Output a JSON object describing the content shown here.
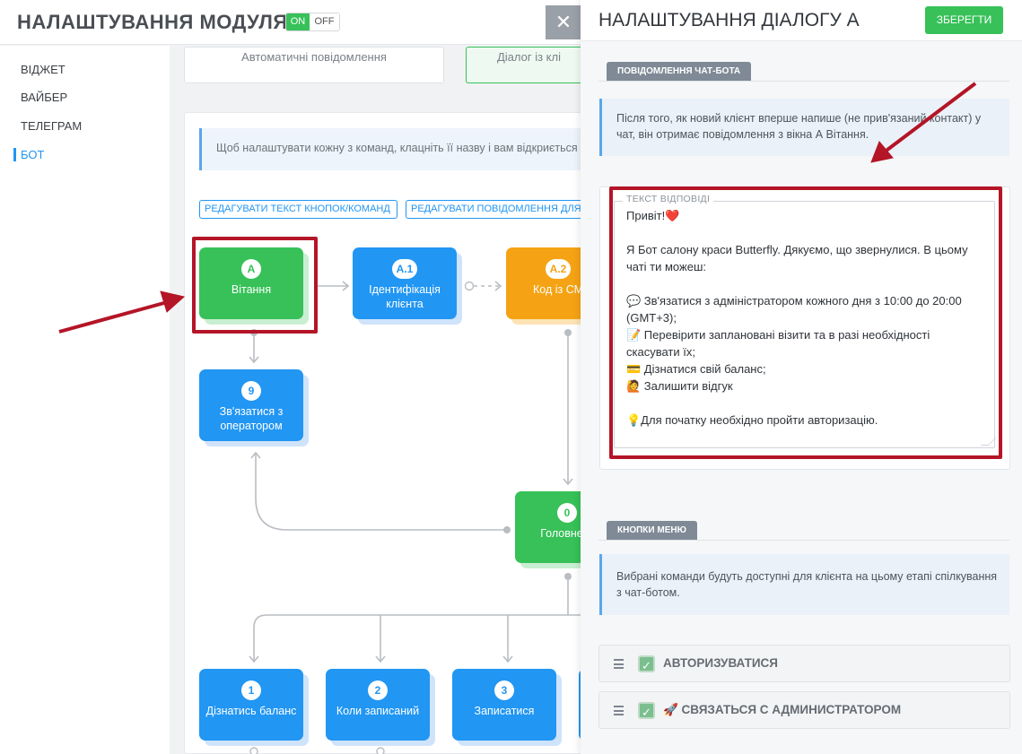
{
  "header": {
    "module_title": "НАЛАШТУВАННЯ МОДУЛЯ",
    "toggle_on": "ON",
    "toggle_off": "OFF"
  },
  "sidebar": {
    "items": [
      {
        "label": "ВІДЖЕТ",
        "active": false
      },
      {
        "label": "ВАЙБЕР",
        "active": false
      },
      {
        "label": "ТЕЛЕГРАМ",
        "active": false
      },
      {
        "label": "БОТ",
        "active": true
      }
    ]
  },
  "main": {
    "tabs": [
      {
        "label": "Автоматичні повідомлення"
      },
      {
        "label": "Діалог із клі"
      }
    ],
    "hint": "Щоб налаштувати кожну з команд, клацніть її назву і вам відкриється",
    "edit_buttons_label": "РЕДАГУВАТИ ТЕКСТ КНОПОК/КОМАНД",
    "edit_messages_label": "РЕДАГУВАТИ ПОВІДОМЛЕННЯ ДЛЯ",
    "nodes": [
      {
        "id": "A",
        "label": "Вітання",
        "color": "green"
      },
      {
        "id": "A.1",
        "label": "Ідентифікація клієнта",
        "color": "blue"
      },
      {
        "id": "A.2",
        "label": "Код із СМ",
        "color": "orange"
      },
      {
        "id": "9",
        "label": "Зв'язатися з оператором",
        "color": "blue"
      },
      {
        "id": "0",
        "label": "Головне м",
        "color": "green"
      },
      {
        "id": "1",
        "label": "Дізнатись баланс",
        "color": "blue"
      },
      {
        "id": "2",
        "label": "Коли записаний",
        "color": "blue"
      },
      {
        "id": "3",
        "label": "Записатися",
        "color": "blue"
      }
    ]
  },
  "close_icon": "close-icon",
  "panel": {
    "title": "НАЛАШТУВАННЯ ДІАЛОГУ А",
    "save_label": "ЗБЕРЕГТИ",
    "chatbot_section": "ПОВІДОМЛЕННЯ ЧАТ-БОТА",
    "chatbot_info": "Після того, як новий клієнт вперше напише (не прив'язаний контакт) у чат, він отримає повідомлення з вікна А Вітання.",
    "answer_legend": "ТЕКСТ ВІДПОВІДІ",
    "answer_lines": [
      "Привіт!❤️",
      "",
      "Я Бот салону краси Butterfly. Дякуємо, що звернулися. В цьому",
      "чаті ти можеш:",
      "",
      "💬 Зв'язатися з адміністратором кожного дня з 10:00 до 20:00",
      "(GMT+3);",
      "📝 Перевірити заплановані візити та в разі необхідності",
      "скасувати їх;",
      "💳 Дізнатися свій баланс;",
      "🙋 Залишити відгук",
      "",
      "💡Для початку необхідно пройти авторизацію."
    ],
    "menu_section": "КНОПКИ МЕНЮ",
    "menu_info": "Вибрані команди будуть доступні для клієнта на цьому етапі спілкування з чат-ботом.",
    "menu_items": [
      {
        "label": "АВТОРИЗУВАТИСЯ",
        "checked": true
      },
      {
        "label": "🚀 СВЯЗАТЬСЯ С АДМИНИСТРАТОРОМ",
        "checked": true
      }
    ]
  },
  "colors": {
    "accent_green": "#37c158",
    "accent_blue": "#2196f3",
    "accent_orange": "#f5a314",
    "highlight_red": "#b41527"
  }
}
